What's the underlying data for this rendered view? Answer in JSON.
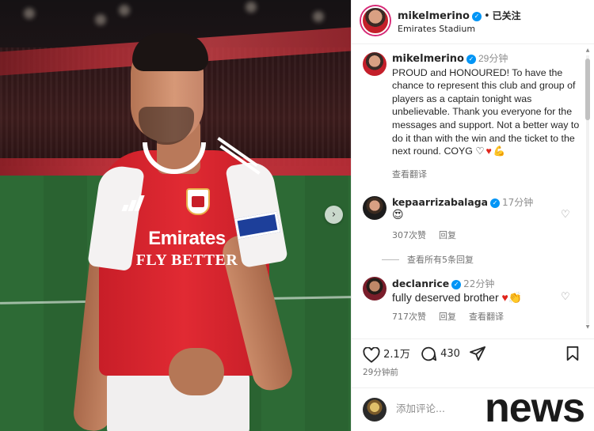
{
  "post": {
    "photo_sponsor_line1": "Emirates",
    "photo_sponsor_line2": "FLY BETTER",
    "next_arrow": "›"
  },
  "header": {
    "username": "mikelmerino",
    "verified_icon": "✓",
    "separator": "•",
    "follow_status": "已关注",
    "location": "Emirates Stadium"
  },
  "caption": {
    "username": "mikelmerino",
    "time": "29分钟",
    "text": "PROUD and HONOURED! To have the chance to represent this club and group of players as a captain tonight was unbelievable. Thank you everyone for the messages and support. Not a better way to do it than with the win and the ticket to the next round. COYG",
    "emojis": [
      "♡",
      "♥",
      "💪"
    ],
    "see_translation": "查看翻译"
  },
  "comments": [
    {
      "username": "kepaarrizabalaga",
      "time": "17分钟",
      "text": "😍",
      "likes": "307次赞",
      "reply": "回复"
    },
    {
      "username": "declanrice",
      "time": "22分钟",
      "text": "fully deserved brother",
      "emojis": [
        "♥",
        "👏"
      ],
      "likes": "717次赞",
      "reply": "回复",
      "see_translation": "查看翻译"
    }
  ],
  "view_replies": "查看所有5条回复",
  "actions": {
    "like_count": "2.1万",
    "comment_count": "430",
    "posted_ago": "29分钟前"
  },
  "composer": {
    "placeholder": "添加评论..."
  },
  "watermark": "news",
  "colors": {
    "verified": "#0095f6",
    "heart_red": "#e0241b",
    "arsenal_red": "#e12a33",
    "muted_text": "#737373"
  }
}
